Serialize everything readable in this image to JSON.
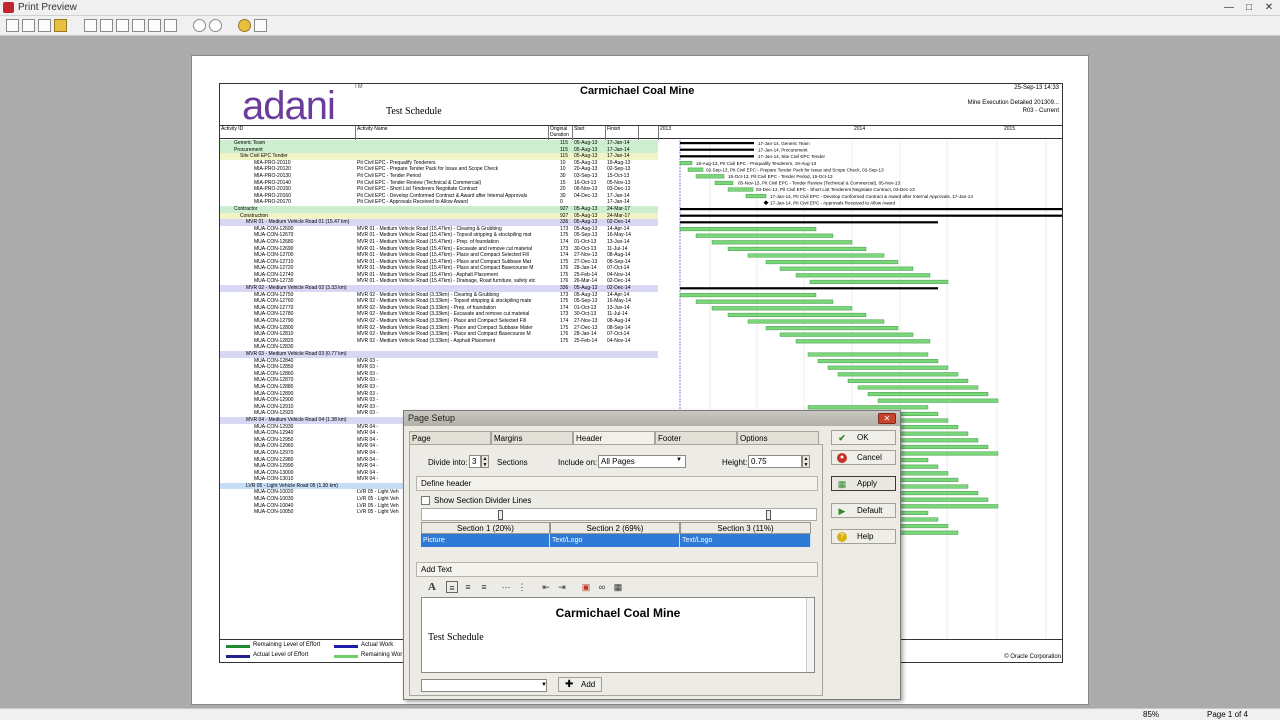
{
  "window": {
    "title": "Print Preview"
  },
  "status": {
    "zoom": "85%",
    "page": "Page 1 of 4"
  },
  "report": {
    "logo": "adani",
    "logo_mark": "TM",
    "subtitle": "Test Schedule",
    "title": "Carmichael Coal Mine",
    "date": "25-Sep-13 14:33",
    "line2": "Mine Execution Detailed 201309...",
    "line3": "R03 - Current",
    "headers": {
      "activity_id": "Activity ID",
      "activity_name": "Activity Name",
      "duration": "Original Duration",
      "start": "Start",
      "finish": "Finish",
      "year1": "2013",
      "year2": "2014",
      "year3": "2015"
    },
    "rows": [
      {
        "id": "Generic Team",
        "name": "",
        "dur": "115",
        "start": "05-Aug-13",
        "finish": "17-Jan-14",
        "lvl": "l1"
      },
      {
        "id": "Procurement",
        "name": "",
        "dur": "115",
        "start": "05-Aug-13",
        "finish": "17-Jan-14",
        "lvl": "l1"
      },
      {
        "id": "Site Civil EPC Tender",
        "name": "",
        "dur": "115",
        "start": "05-Aug-13",
        "finish": "17-Jan-14",
        "lvl": "l2"
      },
      {
        "id": "MIA-PRO-20110",
        "name": "Pit Civil EPC - Prequalify Tenderers",
        "dur": "10",
        "start": "05-Aug-13",
        "finish": "19-Aug-13",
        "lvl": ""
      },
      {
        "id": "MIA-PRO-20120",
        "name": "Pit Civil EPC - Prepare Tender Pack for Issue and Scope Check",
        "dur": "10",
        "start": "20-Aug-13",
        "finish": "02-Sep-13",
        "lvl": ""
      },
      {
        "id": "MIA-PRO-20130",
        "name": "Pit Civil EPC - Tender Period",
        "dur": "30",
        "start": "03-Sep-13",
        "finish": "15-Oct-13",
        "lvl": ""
      },
      {
        "id": "MIA-PRO-20140",
        "name": "Pit Civil EPC - Tender Review (Technical & Commercial)",
        "dur": "15",
        "start": "16-Oct-13",
        "finish": "05-Nov-13",
        "lvl": ""
      },
      {
        "id": "MIA-PRO-20150",
        "name": "Pit Civil EPC - Short List Tenderers Negotiate Contract",
        "dur": "20",
        "start": "06-Nov-13",
        "finish": "03-Dec-13",
        "lvl": ""
      },
      {
        "id": "MIA-PRO-20160",
        "name": "Pit Civil EPC - Develop Conformed Contract & Award after Internal Approvals",
        "dur": "30",
        "start": "04-Dec-13",
        "finish": "17-Jan-14",
        "lvl": ""
      },
      {
        "id": "MIA-PRO-20170",
        "name": "Pit Civil EPC - Approvals Received to Allow Award",
        "dur": "0",
        "start": "",
        "finish": "17-Jan-14",
        "lvl": ""
      },
      {
        "id": "Contractor",
        "name": "",
        "dur": "927",
        "start": "05-Aug-13",
        "finish": "24-Mar-17",
        "lvl": "l1"
      },
      {
        "id": "Construction",
        "name": "",
        "dur": "927",
        "start": "05-Aug-13",
        "finish": "24-Mar-17",
        "lvl": "l2"
      },
      {
        "id": "MVR 01 - Medium Vehicle Road 01 (15.47 km)",
        "name": "",
        "dur": "336",
        "start": "05-Aug-13",
        "finish": "02-Dec-14",
        "lvl": "l3"
      },
      {
        "id": "MUA-CON-12690",
        "name": "MVR 01 - Medium Vehicle Road (15.47km) - Clearing & Grubbing",
        "dur": "173",
        "start": "05-Aug-13",
        "finish": "14-Apr-14",
        "lvl": ""
      },
      {
        "id": "MUA-CON-12670",
        "name": "MVR 01 - Medium Vehicle Road (15.47km) - Topsoil stripping & stockpiling mat",
        "dur": "175",
        "start": "05-Sep-13",
        "finish": "16-May-14",
        "lvl": ""
      },
      {
        "id": "MUA-CON-12680",
        "name": "MVR 01 - Medium Vehicle Road (15.47km) - Prep. of foundation",
        "dur": "174",
        "start": "01-Oct-13",
        "finish": "13-Jun-14",
        "lvl": ""
      },
      {
        "id": "MUA-CON-12690",
        "name": "MVR 01 - Medium Vehicle Road (15.47km) - Excavate and remove cut material",
        "dur": "173",
        "start": "30-Oct-13",
        "finish": "11-Jul-14",
        "lvl": ""
      },
      {
        "id": "MUA-CON-12700",
        "name": "MVR 01 - Medium Vehicle Road (15.47km) - Place and Compact Selected Fill",
        "dur": "174",
        "start": "27-Nov-13",
        "finish": "08-Aug-14",
        "lvl": ""
      },
      {
        "id": "MUA-CON-12710",
        "name": "MVR 01 - Medium Vehicle Road (15.47km) - Place and Compact Subbase Mat",
        "dur": "175",
        "start": "27-Dec-13",
        "finish": "08-Sep-14",
        "lvl": ""
      },
      {
        "id": "MUA-CON-12720",
        "name": "MVR 01 - Medium Vehicle Road (15.47km) - Place and Compact Basecourse M",
        "dur": "176",
        "start": "28-Jan-14",
        "finish": "07-Oct-14",
        "lvl": ""
      },
      {
        "id": "MUA-CON-12740",
        "name": "MVR 01 - Medium Vehicle Road (15.47km) - Asphalt Placement",
        "dur": "175",
        "start": "25-Feb-14",
        "finish": "04-Nov-14",
        "lvl": ""
      },
      {
        "id": "MUA-CON-12730",
        "name": "MVR 01 - Medium Vehicle Road (15.47km) - Drainage, Road furniture, safety etc",
        "dur": "176",
        "start": "26-Mar-14",
        "finish": "02-Dec-14",
        "lvl": ""
      },
      {
        "id": "MVR 02 - Medium Vehicle Road 02 (3.33 km)",
        "name": "",
        "dur": "336",
        "start": "05-Aug-13",
        "finish": "02-Dec-14",
        "lvl": "l3"
      },
      {
        "id": "MUA-CON-12750",
        "name": "MVR 02 - Medium Vehicle Road (3.33km) - Clearing & Grubbing",
        "dur": "173",
        "start": "05-Aug-13",
        "finish": "14-Apr-14",
        "lvl": ""
      },
      {
        "id": "MUA-CON-12760",
        "name": "MVR 02 - Medium Vehicle Road (3.33km) - Topsoil stripping & stockpiling mate",
        "dur": "175",
        "start": "05-Sep-13",
        "finish": "16-May-14",
        "lvl": ""
      },
      {
        "id": "MUA-CON-12770",
        "name": "MVR 02 - Medium Vehicle Road (3.33km) - Prep. of foundation",
        "dur": "174",
        "start": "01-Oct-13",
        "finish": "13-Jun-14",
        "lvl": ""
      },
      {
        "id": "MUA-CON-12780",
        "name": "MVR 02 - Medium Vehicle Road (3.33km) - Excavate and remove cut material",
        "dur": "173",
        "start": "30-Oct-13",
        "finish": "11-Jul-14",
        "lvl": ""
      },
      {
        "id": "MUA-CON-12790",
        "name": "MVR 02 - Medium Vehicle Road (3.33km) - Place and Compact Selected Fill",
        "dur": "174",
        "start": "27-Nov-13",
        "finish": "08-Aug-14",
        "lvl": ""
      },
      {
        "id": "MUA-CON-12800",
        "name": "MVR 02 - Medium Vehicle Road (3.33km) - Place and Compact Subbase Mater",
        "dur": "175",
        "start": "27-Dec-13",
        "finish": "08-Sep-14",
        "lvl": ""
      },
      {
        "id": "MUA-CON-12810",
        "name": "MVR 02 - Medium Vehicle Road (3.33km) - Place and Compact Basecourse M",
        "dur": "176",
        "start": "28-Jan-14",
        "finish": "07-Oct-14",
        "lvl": ""
      },
      {
        "id": "MUA-CON-12820",
        "name": "MVR 02 - Medium Vehicle Road (3.33km) - Asphalt Placement",
        "dur": "175",
        "start": "25-Feb-14",
        "finish": "04-Nov-14",
        "lvl": ""
      },
      {
        "id": "MUA-CON-12830",
        "name": "",
        "dur": "",
        "start": "",
        "finish": "",
        "lvl": ""
      },
      {
        "id": "MVR 03 - Medium Vehicle Road 03 (0.77 km)",
        "name": "",
        "dur": "",
        "start": "",
        "finish": "",
        "lvl": "l3"
      },
      {
        "id": "MUA-CON-12840",
        "name": "MVR 03 -",
        "dur": "",
        "start": "",
        "finish": "",
        "lvl": ""
      },
      {
        "id": "MUA-CON-12850",
        "name": "MVR 03 -",
        "dur": "",
        "start": "",
        "finish": "",
        "lvl": ""
      },
      {
        "id": "MUA-CON-12860",
        "name": "MVR 03 -",
        "dur": "",
        "start": "",
        "finish": "",
        "lvl": ""
      },
      {
        "id": "MUA-CON-12870",
        "name": "MVR 03 -",
        "dur": "",
        "start": "",
        "finish": "",
        "lvl": ""
      },
      {
        "id": "MUA-CON-12880",
        "name": "MVR 03 -",
        "dur": "",
        "start": "",
        "finish": "",
        "lvl": ""
      },
      {
        "id": "MUA-CON-12890",
        "name": "MVR 03 -",
        "dur": "",
        "start": "",
        "finish": "",
        "lvl": ""
      },
      {
        "id": "MUA-CON-12900",
        "name": "MVR 03 -",
        "dur": "",
        "start": "",
        "finish": "",
        "lvl": ""
      },
      {
        "id": "MUA-CON-12910",
        "name": "MVR 03 -",
        "dur": "",
        "start": "",
        "finish": "",
        "lvl": ""
      },
      {
        "id": "MUA-CON-12920",
        "name": "MVR 03 -",
        "dur": "",
        "start": "",
        "finish": "",
        "lvl": ""
      },
      {
        "id": "MVR 04 - Medium Vehicle Road 04 (1.38 km)",
        "name": "",
        "dur": "",
        "start": "",
        "finish": "",
        "lvl": "l3"
      },
      {
        "id": "MUA-CON-12930",
        "name": "MVR 04 -",
        "dur": "",
        "start": "",
        "finish": "",
        "lvl": ""
      },
      {
        "id": "MUA-CON-12940",
        "name": "MVR 04 -",
        "dur": "",
        "start": "",
        "finish": "",
        "lvl": ""
      },
      {
        "id": "MUA-CON-12950",
        "name": "MVR 04 -",
        "dur": "",
        "start": "",
        "finish": "",
        "lvl": ""
      },
      {
        "id": "MUA-CON-12960",
        "name": "MVR 04 -",
        "dur": "",
        "start": "",
        "finish": "",
        "lvl": ""
      },
      {
        "id": "MUA-CON-12970",
        "name": "MVR 04 -",
        "dur": "",
        "start": "",
        "finish": "",
        "lvl": ""
      },
      {
        "id": "MUA-CON-12980",
        "name": "MVR 04 -",
        "dur": "",
        "start": "",
        "finish": "",
        "lvl": ""
      },
      {
        "id": "MUA-CON-12990",
        "name": "MVR 04 -",
        "dur": "",
        "start": "",
        "finish": "",
        "lvl": ""
      },
      {
        "id": "MUA-CON-13000",
        "name": "MVR 04 -",
        "dur": "",
        "start": "",
        "finish": "",
        "lvl": ""
      },
      {
        "id": "MUA-CON-13010",
        "name": "MVR 04 -",
        "dur": "",
        "start": "",
        "finish": "",
        "lvl": ""
      },
      {
        "id": "LVR 05 - Light Vehicle Road 05 (1.30 km)",
        "name": "",
        "dur": "",
        "start": "",
        "finish": "",
        "lvl": "l4"
      },
      {
        "id": "MUA-CON-10020",
        "name": "LVR 05 - Light Veh",
        "dur": "",
        "start": "",
        "finish": "",
        "lvl": ""
      },
      {
        "id": "MUA-CON-10030",
        "name": "LVR 05 - Light Veh",
        "dur": "",
        "start": "",
        "finish": "",
        "lvl": ""
      },
      {
        "id": "MUA-CON-10040",
        "name": "LVR 05 - Light Veh",
        "dur": "",
        "start": "",
        "finish": "",
        "lvl": ""
      },
      {
        "id": "MUA-CON-10050",
        "name": "LVR 05 - Light Veh",
        "dur": "",
        "start": "",
        "finish": "",
        "lvl": ""
      }
    ],
    "gantt_labels": [
      "17-Jan-14, Generic Team",
      "17-Jan-14, Procurement",
      "17-Jan-14, Site Civil EPC Tender",
      "19-Aug-13, Pit Civil EPC - Prequalify Tenderers, 19-Aug-13",
      "02-Sep-13, Pit Civil EPC - Prepare Tender Pack for Issue and Scope Check, 02-Sep-13",
      "15-Oct-13, Pit Civil EPC - Tender Period, 15-Oct-13",
      "05-Nov-13, Pit Civil EPC - Tender Review (Technical & Commercial), 05-Nov-13",
      "03-Dec-13, Pit Civil EPC - Short List Tenderers Negotiate Contract, 03-Dec-13",
      "17-Jan-14, Pit Civil EPC - Develop Conformed Contract & Award after Internal Approvals, 17-Jan-14",
      "17-Jan-14, Pit Civil EPC - Approvals Received to Allow Award"
    ],
    "legend": {
      "remaining_loe": "Remaining Level of Effort",
      "actual_loe": "Actual Level of Effort",
      "actual_work": "Actual Work",
      "remaining_work": "Remaining Wor",
      "footer": "© Oracle Corporation"
    }
  },
  "dialog": {
    "title": "Page Setup",
    "tabs": [
      "Page",
      "Margins",
      "Header",
      "Footer",
      "Options"
    ],
    "divide_into_label": "Divide into:",
    "divide_into_value": "3",
    "sections_label": "Sections",
    "include_on_label": "Include on:",
    "include_on_value": "All Pages",
    "height_label": "Height:",
    "height_value": "0.75",
    "define_header_label": "Define header",
    "show_divider_label": "Show Section Divider Lines",
    "sections": [
      {
        "head": "Section 1 (20%)",
        "content": "Picture"
      },
      {
        "head": "Section 2 (69%)",
        "content": "Text/Logo"
      },
      {
        "head": "Section 3 (11%)",
        "content": "Text/Logo"
      }
    ],
    "add_text_label": "Add Text",
    "editor_title": "Carmichael Coal Mine",
    "editor_subtitle": "Test Schedule",
    "add_button": "Add",
    "buttons": {
      "ok": "OK",
      "cancel": "Cancel",
      "apply": "Apply",
      "default": "Default",
      "help": "Help"
    },
    "colors": {
      "ok": "#2e8b2e",
      "cancel": "#c8302a",
      "default": "#2e8b2e",
      "help": "#d8b010",
      "section_fill": "#2f7ad6"
    }
  }
}
